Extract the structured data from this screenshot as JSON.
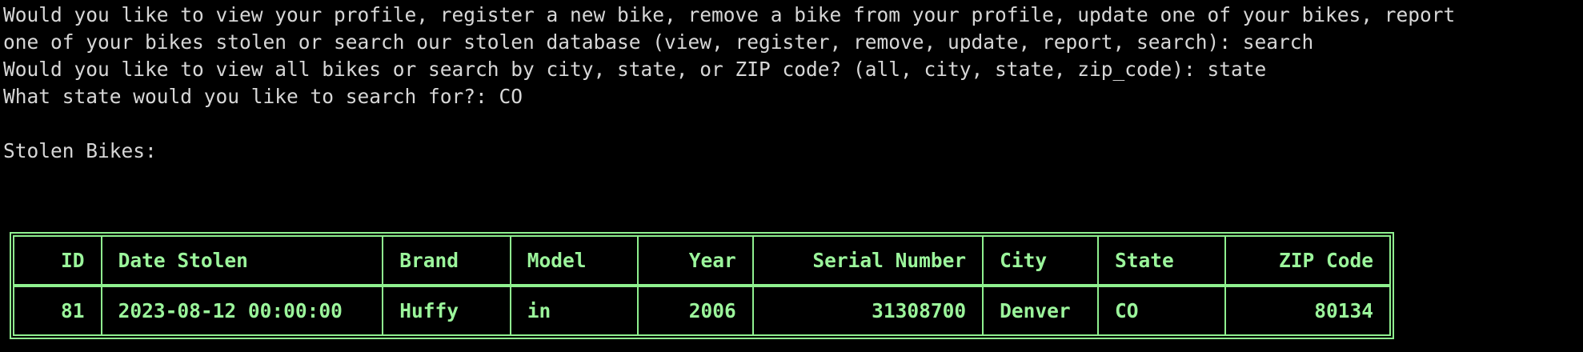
{
  "terminal": {
    "lines": [
      "Would you like to view your profile, register a new bike, remove a bike from your profile, update one of your bikes, report",
      "one of your bikes stolen or search our stolen database (view, register, remove, update, report, search): search",
      "Would you like to view all bikes or search by city, state, or ZIP code? (all, city, state, zip_code): state",
      "What state would you like to search for?: CO",
      "Stolen Bikes:"
    ]
  },
  "colors": {
    "background": "#000000",
    "text": "#d7d7d7",
    "table_text": "#9bf59b",
    "table_border": "#8ff08f"
  },
  "table": {
    "headers": [
      "ID",
      "Date Stolen",
      "Brand",
      "Model",
      "Year",
      "Serial Number",
      "City",
      "State",
      "ZIP Code"
    ],
    "rows": [
      [
        "81",
        "2023-08-12 00:00:00",
        "Huffy",
        "in",
        "2006",
        "31308700",
        "Denver",
        "CO",
        "80134"
      ]
    ]
  }
}
